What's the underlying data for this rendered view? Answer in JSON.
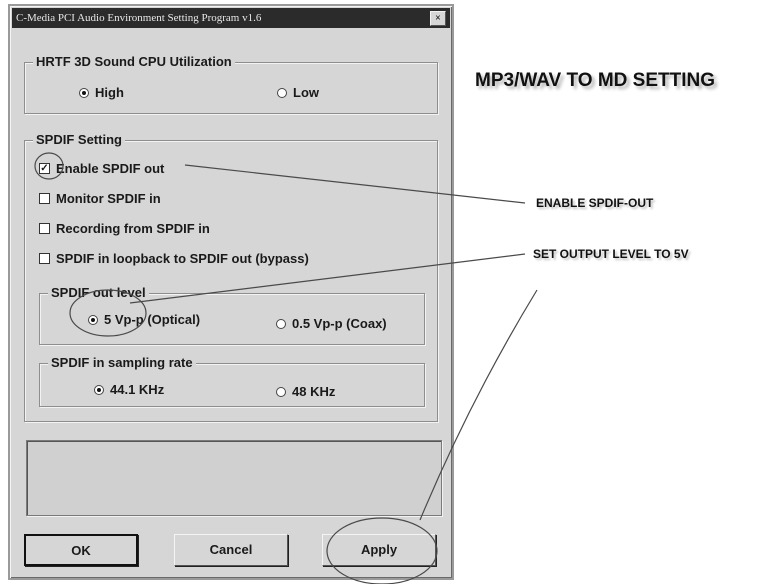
{
  "window": {
    "title": "C-Media PCI Audio Environment Setting Program v1.6",
    "close_glyph": "×"
  },
  "hrtf": {
    "legend": "HRTF 3D Sound CPU Utilization",
    "options": [
      {
        "label": "High",
        "selected": true
      },
      {
        "label": "Low",
        "selected": false
      }
    ]
  },
  "spdif": {
    "legend": "SPDIF Setting",
    "checkboxes": [
      {
        "label": "Enable SPDIF out",
        "checked": true
      },
      {
        "label": "Monitor SPDIF in",
        "checked": false
      },
      {
        "label": "Recording from SPDIF in",
        "checked": false
      },
      {
        "label": "SPDIF in loopback to SPDIF out (bypass)",
        "checked": false
      }
    ],
    "out_level": {
      "legend": "SPDIF out level",
      "options": [
        {
          "label": "5 Vp-p (Optical)",
          "selected": true
        },
        {
          "label": "0.5 Vp-p (Coax)",
          "selected": false
        }
      ]
    },
    "sampling_rate": {
      "legend": "SPDIF in sampling rate",
      "options": [
        {
          "label": "44.1 KHz",
          "selected": true
        },
        {
          "label": "48 KHz",
          "selected": false
        }
      ]
    }
  },
  "buttons": {
    "ok": "OK",
    "cancel": "Cancel",
    "apply": "Apply"
  },
  "annotations": {
    "heading": "MP3/WAV TO MD SETTING",
    "enable_spdif_out": "ENABLE SPDIF-OUT",
    "set_output_level": "SET OUTPUT LEVEL TO 5V"
  },
  "check_glyph": "✓"
}
